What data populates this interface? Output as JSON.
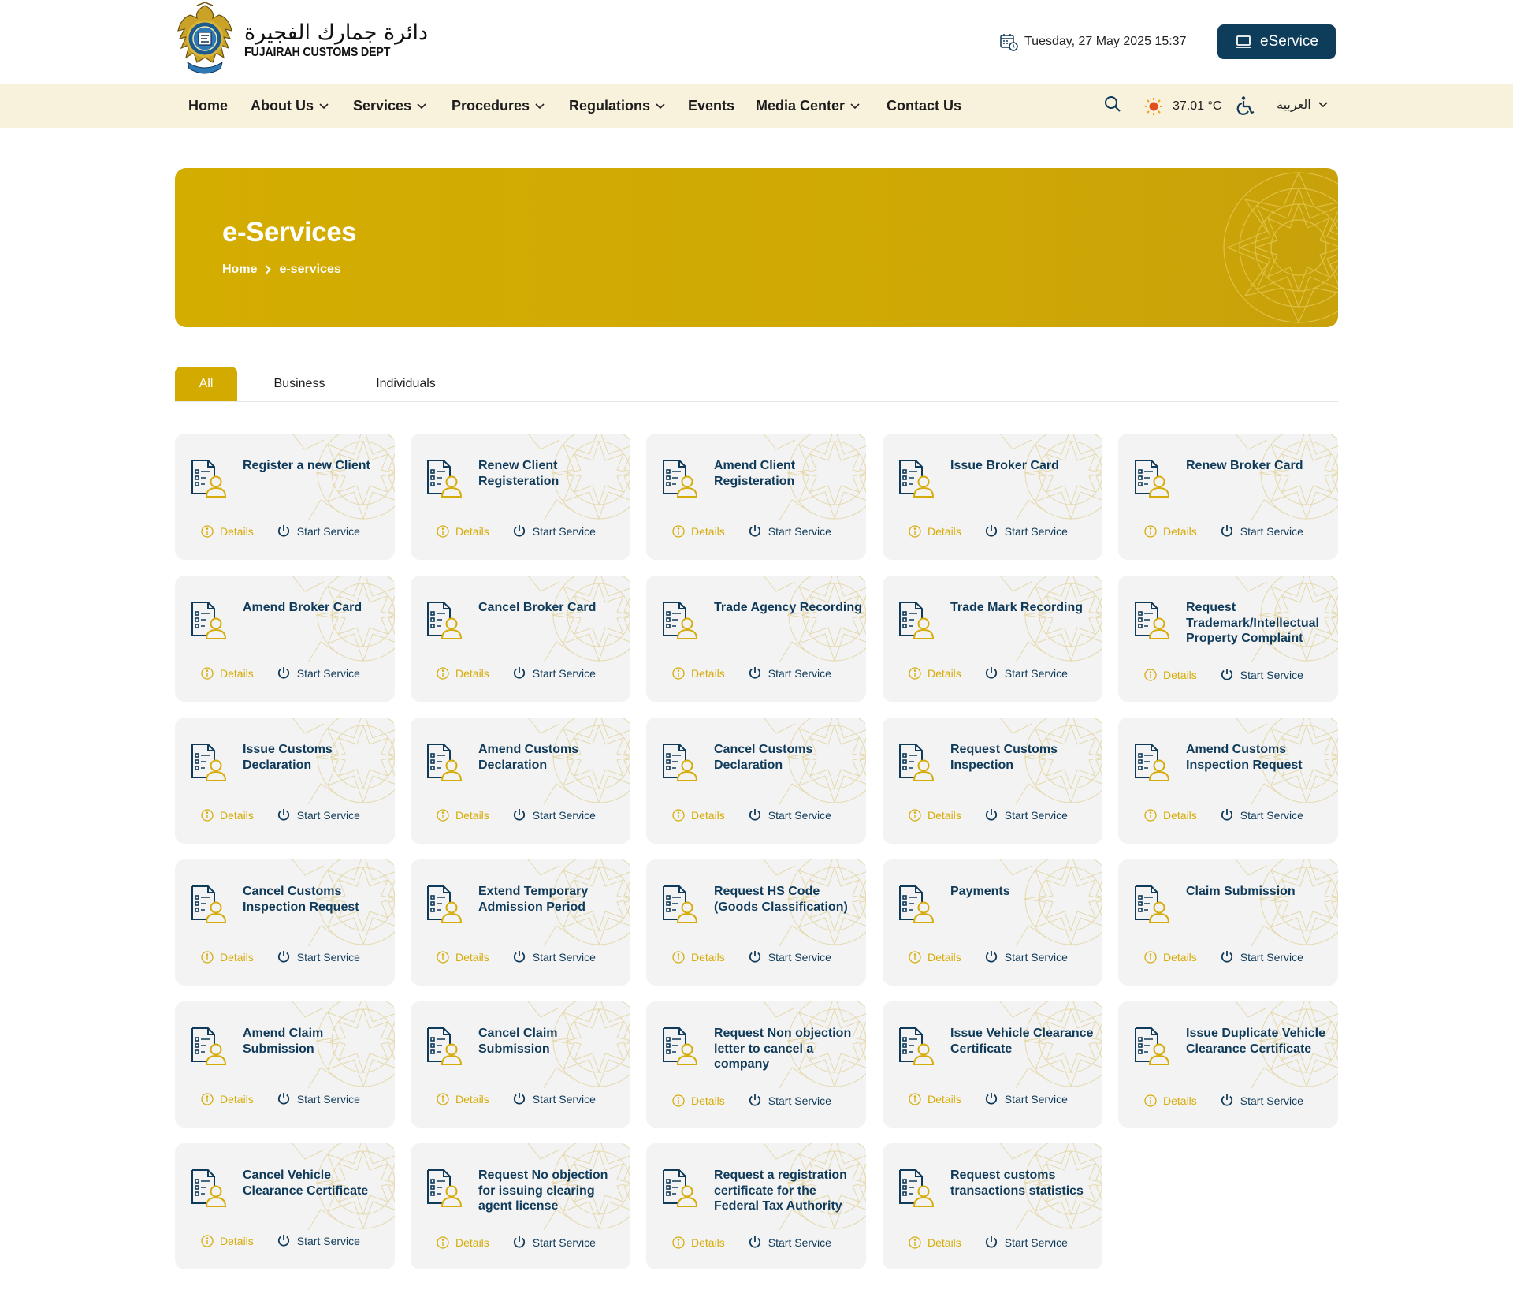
{
  "header": {
    "logo_arabic": "دائرة جمارك الفجيرة",
    "logo_english": "FUJAIRAH CUSTOMS DEPT",
    "datetime": "Tuesday, 27 May 2025 15:37",
    "eservice_label": "eService"
  },
  "nav": {
    "items": [
      {
        "label": "Home",
        "has_dropdown": false
      },
      {
        "label": "About Us",
        "has_dropdown": true
      },
      {
        "label": "Services",
        "has_dropdown": true
      },
      {
        "label": "Procedures",
        "has_dropdown": true
      },
      {
        "label": "Regulations",
        "has_dropdown": true
      },
      {
        "label": "Events",
        "has_dropdown": false
      },
      {
        "label": "Media Center",
        "has_dropdown": true
      },
      {
        "label": "Contact Us",
        "has_dropdown": false
      }
    ],
    "temperature": "37.01 °C",
    "language": "العربية",
    "icons": [
      "search-icon",
      "sun-icon",
      "accessibility-icon",
      "chevron-down-icon"
    ]
  },
  "hero": {
    "title": "e-Services",
    "breadcrumb": [
      "Home",
      "e-services"
    ]
  },
  "tabs": [
    {
      "label": "All",
      "active": true
    },
    {
      "label": "Business",
      "active": false
    },
    {
      "label": "Individuals",
      "active": false
    }
  ],
  "card_actions": {
    "details_label": "Details",
    "start_label": "Start Service"
  },
  "services": [
    "Register a new Client",
    "Renew Client Registeration",
    "Amend Client Registeration",
    "Issue Broker Card",
    "Renew Broker Card",
    "Amend Broker Card",
    "Cancel Broker Card",
    "Trade Agency Recording",
    "Trade Mark Recording",
    "Request Trademark/Intellectual Property Complaint",
    "Issue Customs Declaration",
    "Amend Customs Declaration",
    "Cancel Customs Declaration",
    "Request Customs Inspection",
    "Amend Customs Inspection Request",
    "Cancel Customs Inspection Request",
    "Extend Temporary Admission Period",
    "Request HS Code (Goods Classification)",
    "Payments",
    "Claim Submission",
    "Amend Claim Submission",
    "Cancel Claim Submission",
    "Request Non objection letter to cancel a company",
    "Issue Vehicle Clearance Certificate",
    "Issue Duplicate Vehicle Clearance Certificate",
    "Cancel Vehicle Clearance Certificate",
    "Request No objection for issuing clearing agent license",
    "Request a registration certificate for the Federal Tax Authority",
    "Request customs transactions statistics"
  ],
  "colors": {
    "brand_gold": "#d2aa00",
    "navy": "#0f3a59",
    "nav_bg": "#f8f1dc",
    "card_bg": "#f3f3f3"
  }
}
